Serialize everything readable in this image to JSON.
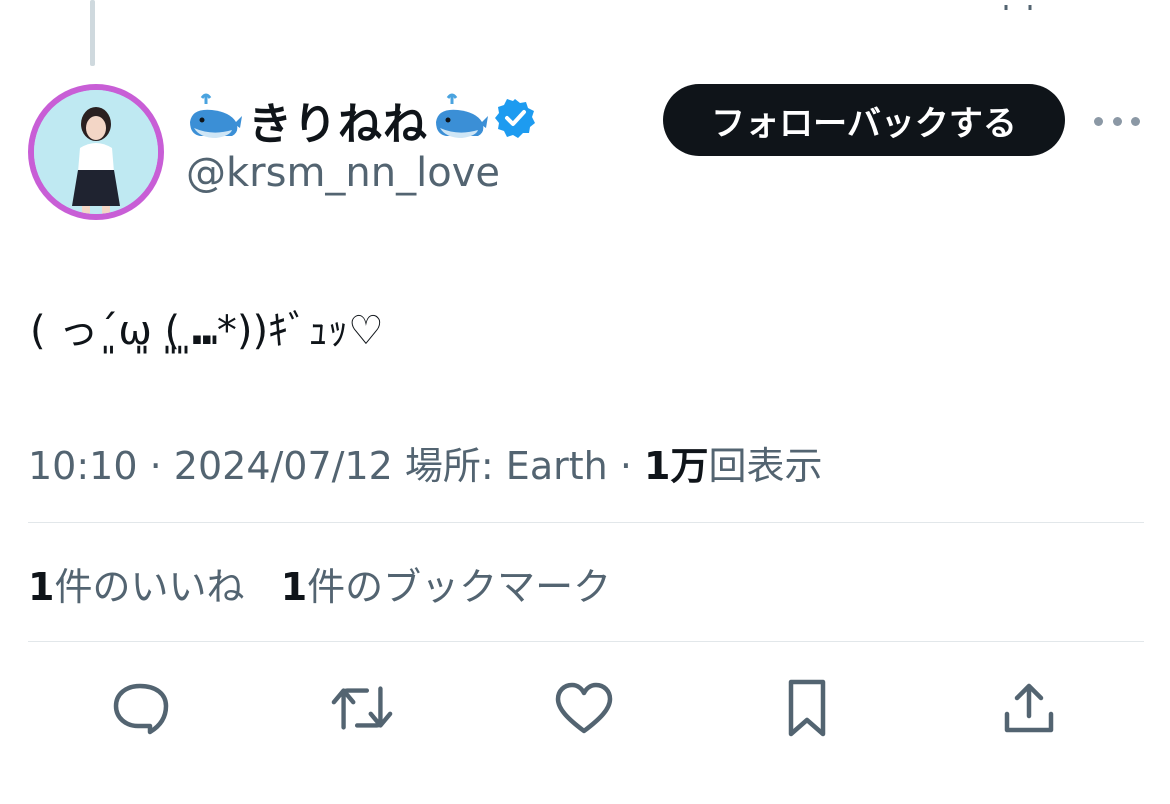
{
  "author": {
    "display_name": "きりねね",
    "name_emoji": "🐳",
    "handle": "@krsm_nn_love",
    "verified_icon": "verified-badge-icon"
  },
  "header": {
    "follow_label": "フォローバックする",
    "more_icon": "more-icon"
  },
  "tweet": {
    "text": "( っ´͈ω͈ (͈ ͈⑉*))ｷﾞｭｯ♡",
    "time": "10:10",
    "date": "2024/07/12",
    "location_label": "場所: Earth",
    "views_count": "1万",
    "views_label": "回表示",
    "separator": "·"
  },
  "stats": {
    "likes_count": "1",
    "likes_label": "件のいいね",
    "bookmarks_count": "1",
    "bookmarks_label": "件のブックマーク"
  },
  "actions": {
    "icons": [
      "reply-icon",
      "retweet-icon",
      "like-icon",
      "bookmark-icon",
      "share-icon"
    ]
  },
  "colors": {
    "text": "#0f1419",
    "muted": "#536471",
    "verified": "#1d9bf0",
    "avatar_ring": "#c85ed6",
    "follow_bg": "#0f1419"
  }
}
